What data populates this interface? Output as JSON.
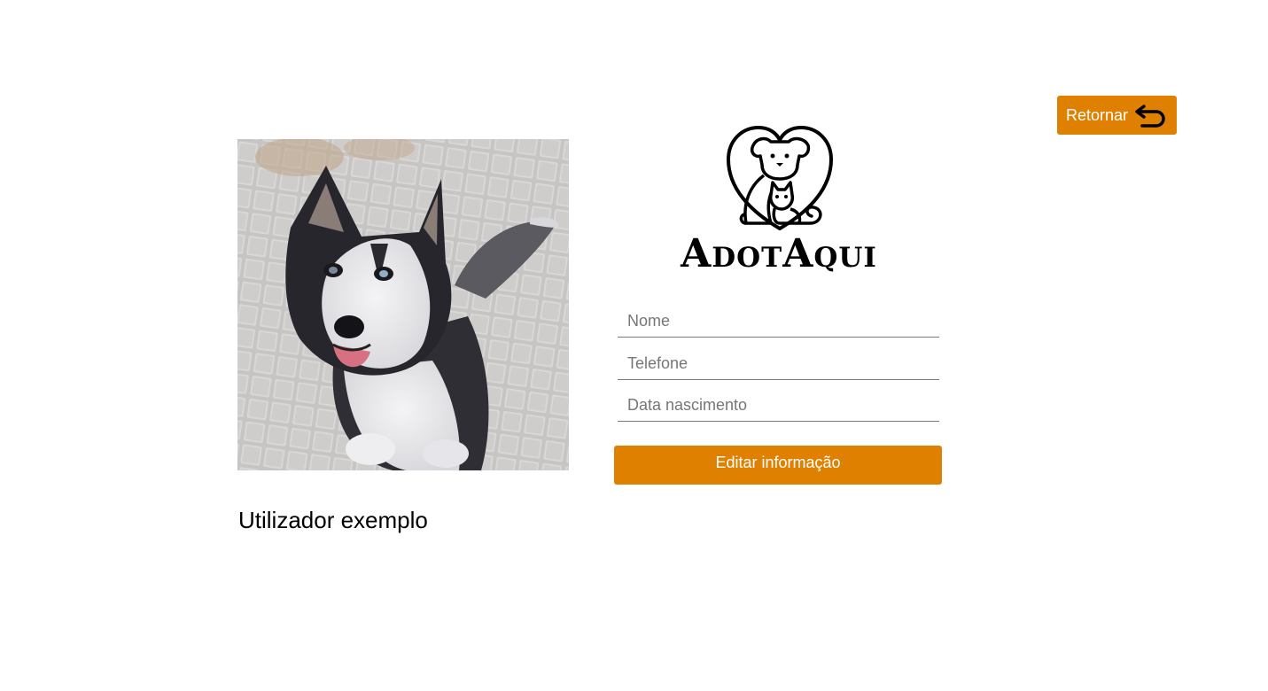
{
  "header": {
    "back_label": "Retornar",
    "back_icon": "return-arrow-icon"
  },
  "profile": {
    "photo": "husky-dog-photo",
    "user_name": "Utilizador exemplo"
  },
  "brand": {
    "name": "AdotAqui",
    "logo_icon": "heart-dog-cat-logo"
  },
  "form": {
    "name_placeholder": "Nome",
    "phone_placeholder": "Telefone",
    "birthdate_placeholder": "Data nascimento",
    "submit_label": "Editar informação"
  },
  "colors": {
    "accent": "#e08000",
    "background": "#ffffff",
    "text": "#000000"
  }
}
